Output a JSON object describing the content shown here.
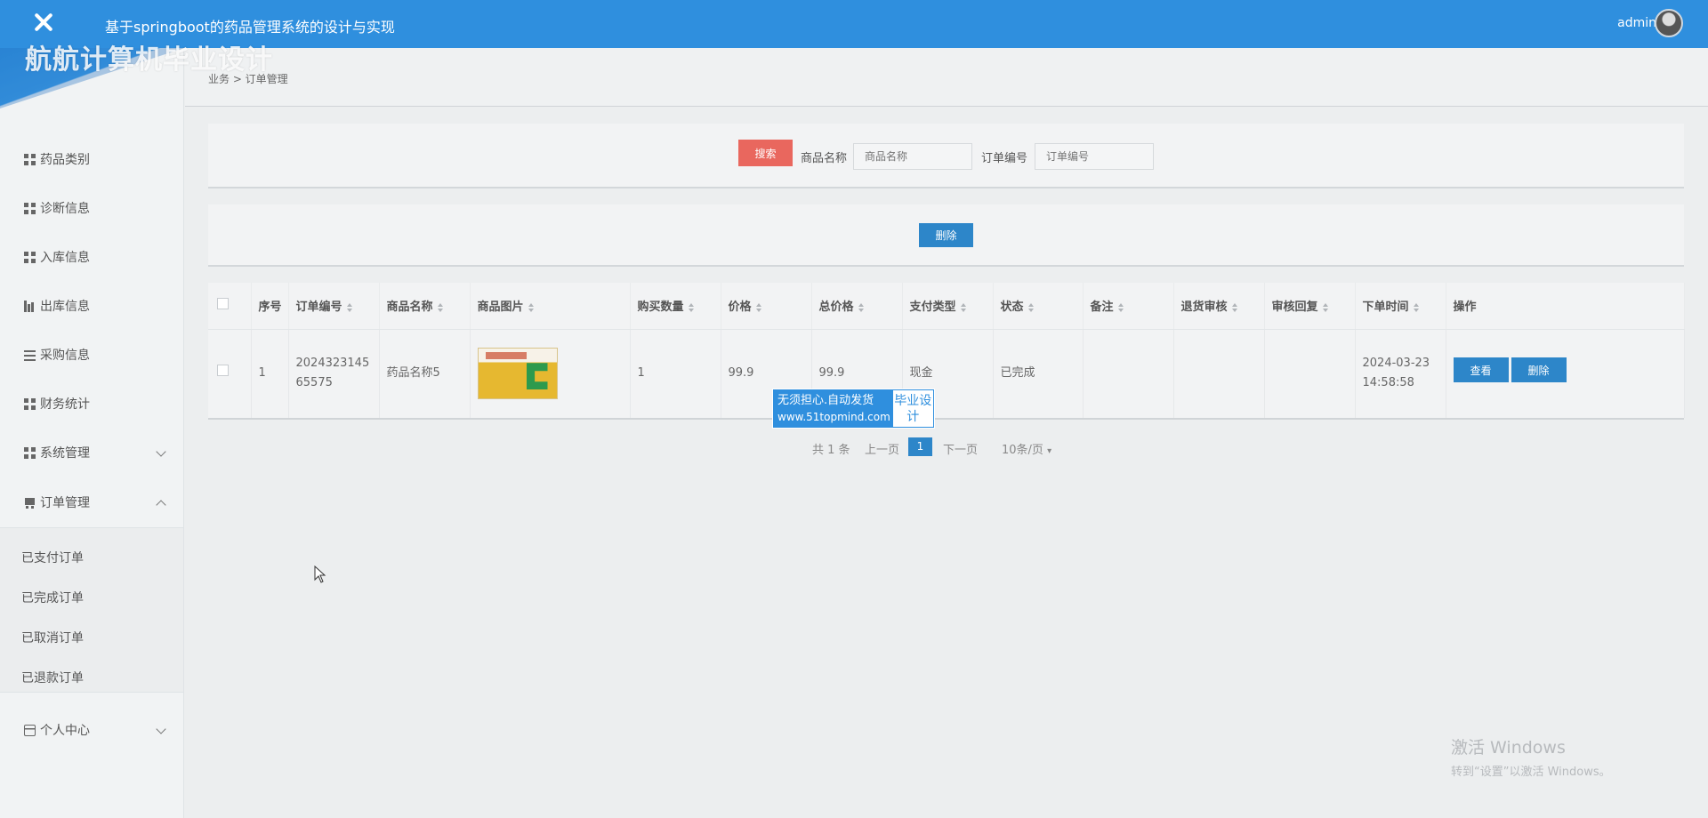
{
  "header": {
    "title": "基于springboot的药品管理系统的设计与实现",
    "user": "admin"
  },
  "brand_watermark": "航航计算机毕业设计",
  "sidebar": {
    "items": [
      {
        "label": "药品类别",
        "icon": "grid-icon"
      },
      {
        "label": "诊断信息",
        "icon": "grid-icon"
      },
      {
        "label": "入库信息",
        "icon": "grid-icon"
      },
      {
        "label": "出库信息",
        "icon": "bar-chart-icon"
      },
      {
        "label": "采购信息",
        "icon": "list-icon"
      },
      {
        "label": "财务统计",
        "icon": "grid-icon"
      },
      {
        "label": "系统管理",
        "icon": "grid-icon"
      },
      {
        "label": "订单管理",
        "icon": "cart-icon"
      },
      {
        "label": "个人中心",
        "icon": "card-icon"
      }
    ],
    "order_submenu": [
      "已支付订单",
      "已完成订单",
      "已取消订单",
      "已退款订单"
    ]
  },
  "breadcrumb": "业务 > 订单管理",
  "search": {
    "button": "搜索",
    "product_name_label": "商品名称",
    "product_name_placeholder": "商品名称",
    "order_no_label": "订单编号",
    "order_no_placeholder": "订单编号"
  },
  "actions": {
    "delete": "删除"
  },
  "table": {
    "headers": [
      "序号",
      "订单编号",
      "商品名称",
      "商品图片",
      "购买数量",
      "价格",
      "总价格",
      "支付类型",
      "状态",
      "备注",
      "退货审核",
      "审核回复",
      "下单时间",
      "操作"
    ],
    "rows": [
      {
        "index": "1",
        "order_no": "202432314565575",
        "product_name": "药品名称5",
        "quantity": "1",
        "price": "99.9",
        "total": "99.9",
        "pay_type": "现金",
        "status": "已完成",
        "remark": "",
        "return_review": "",
        "review_reply": "",
        "order_time": "2024-03-23 14:58:58",
        "view_btn": "查看",
        "delete_btn": "删除"
      }
    ]
  },
  "pagination": {
    "total": "共 1 条",
    "prev": "上一页",
    "current": "1",
    "next": "下一页",
    "page_size": "10条/页"
  },
  "ad_watermark": {
    "line1": "无须担心.自动发货",
    "line2": "www.51topmind.com",
    "tag": "毕业设计"
  },
  "windows_watermark": {
    "line1": "激活 Windows",
    "line2": "转到“设置”以激活 Windows。"
  },
  "colors": {
    "primary": "#2f8fde",
    "button_blue": "#2d86c9",
    "search_red": "#e9675e"
  }
}
